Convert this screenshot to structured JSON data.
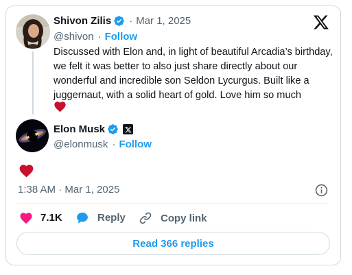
{
  "quoted_post": {
    "author_name": "Shivon Zilis",
    "date": "Mar 1, 2025",
    "handle": "@shivon",
    "follow_label": "Follow",
    "text": "Discussed with Elon and, in light of beautiful Arcadia’s birthday, we felt it was better to also just share directly about our wonderful and incredible son Seldon Lycurgus. Built like a juggernaut, with a solid heart of gold. Love him so much"
  },
  "reply_post": {
    "author_name": "Elon Musk",
    "handle": "@elonmusk",
    "follow_label": "Follow",
    "time": "1:38 AM",
    "date": "Mar 1, 2025"
  },
  "actions": {
    "like_count": "7.1K",
    "reply_label": "Reply",
    "copy_label": "Copy link"
  },
  "read_replies_label": "Read 366 replies",
  "colors": {
    "accent": "#1d9bf0",
    "heart_red": "#c8102e",
    "like_pink": "#f91880",
    "text": "#0f1419",
    "muted": "#536471",
    "border": "#cfd9de"
  },
  "icons": [
    "x-logo-icon",
    "verified-badge-icon",
    "heart-icon",
    "x-badge-icon",
    "info-icon",
    "like-heart-icon",
    "reply-bubble-icon",
    "link-icon"
  ]
}
